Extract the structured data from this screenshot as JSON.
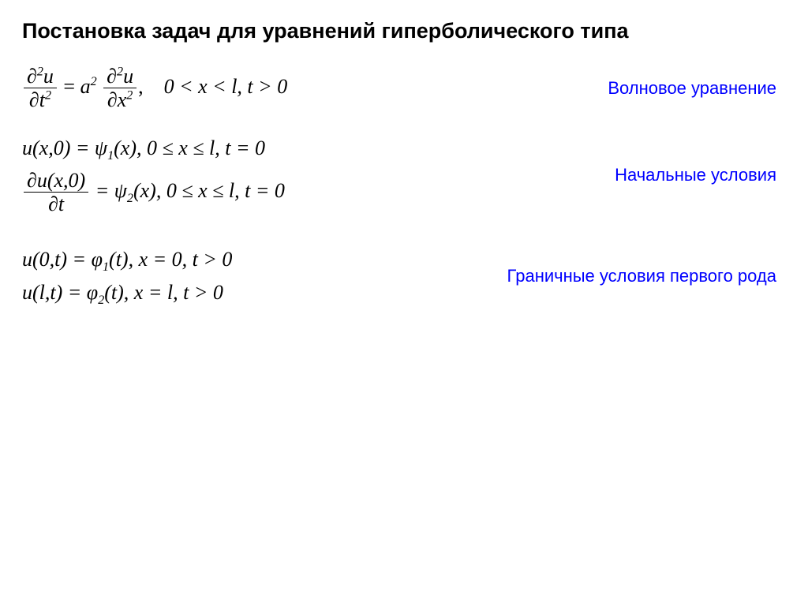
{
  "title": "Постановка задач для уравнений гиперболического типа",
  "wave": {
    "lhs_num": "∂",
    "lhs_num_sup": "2",
    "lhs_num_var": "u",
    "lhs_den": "∂t",
    "lhs_den_sup": "2",
    "eq": "=",
    "coef": "a",
    "coef_sup": "2",
    "rhs_num": "∂",
    "rhs_num_sup": "2",
    "rhs_num_var": "u",
    "rhs_den": "∂x",
    "rhs_den_sup": "2",
    "comma": ",",
    "domain": "0 < x < l,  t > 0",
    "note": "Волновое уравнение"
  },
  "initial": {
    "cond1": "u(x,0) = ψ",
    "cond1_sub": "1",
    "cond1_rest": "(x),    0 ≤ x ≤ l,  t = 0",
    "cond2_num": "∂u(x,0)",
    "cond2_den": "∂t",
    "cond2_eq": " = ψ",
    "cond2_sub": "2",
    "cond2_rest": "(x),   0 ≤ x ≤ l,  t = 0",
    "note": "Начальные условия"
  },
  "boundary": {
    "cond1": "u(0,t) = φ",
    "cond1_sub": "1",
    "cond1_rest": "(t),     x = 0,   t > 0",
    "cond2": "u(l,t) = φ",
    "cond2_sub": "2",
    "cond2_rest": "(t),     x = l,   t > 0",
    "note": "Граничные условия первого рода"
  }
}
